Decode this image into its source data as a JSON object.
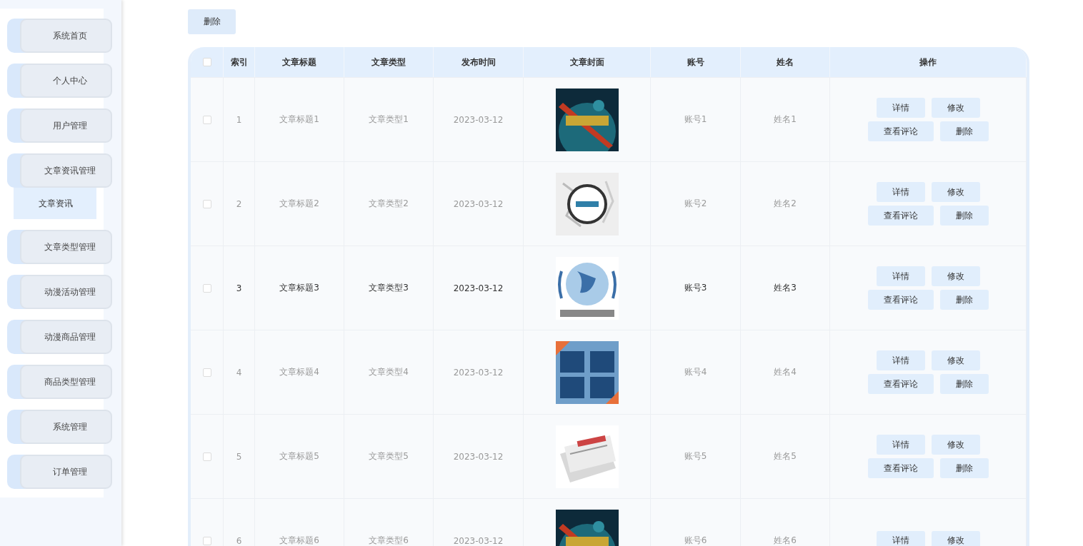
{
  "sidebar": {
    "items": [
      {
        "label": "系统首页",
        "selected": false
      },
      {
        "label": "个人中心",
        "selected": false
      },
      {
        "label": "用户管理",
        "selected": false
      },
      {
        "label": "文章资讯管理",
        "selected": false,
        "expanded": true,
        "children": [
          {
            "label": "文章资讯",
            "selected": true
          }
        ]
      },
      {
        "label": "文章类型管理",
        "selected": false
      },
      {
        "label": "动漫活动管理",
        "selected": false
      },
      {
        "label": "动漫商品管理",
        "selected": false
      },
      {
        "label": "商品类型管理",
        "selected": false
      },
      {
        "label": "系统管理",
        "selected": false
      },
      {
        "label": "订单管理",
        "selected": false
      }
    ]
  },
  "toolbar": {
    "delete_button": "删除"
  },
  "table": {
    "select_all": false,
    "columns": [
      "索引",
      "文章标题",
      "文章类型",
      "发布时间",
      "文章封面",
      "账号",
      "姓名",
      "操作"
    ],
    "rows": [
      {
        "checked": false,
        "hovered": false,
        "index": "1",
        "title": "文章标题1",
        "type": "文章类型1",
        "date": "2023-03-12",
        "account": "账号1",
        "name": "姓名1",
        "actions": [
          "详情",
          "修改",
          "查看评论",
          "删除"
        ]
      },
      {
        "checked": false,
        "hovered": false,
        "index": "2",
        "title": "文章标题2",
        "type": "文章类型2",
        "date": "2023-03-12",
        "account": "账号2",
        "name": "姓名2",
        "actions": [
          "详情",
          "修改",
          "查看评论",
          "删除"
        ]
      },
      {
        "checked": false,
        "hovered": true,
        "index": "3",
        "title": "文章标题3",
        "type": "文章类型3",
        "date": "2023-03-12",
        "account": "账号3",
        "name": "姓名3",
        "actions": [
          "详情",
          "修改",
          "查看评论",
          "删除"
        ]
      },
      {
        "checked": false,
        "hovered": false,
        "index": "4",
        "title": "文章标题4",
        "type": "文章类型4",
        "date": "2023-03-12",
        "account": "账号4",
        "name": "姓名4",
        "actions": [
          "详情",
          "修改",
          "查看评论",
          "删除"
        ]
      },
      {
        "checked": false,
        "hovered": false,
        "index": "5",
        "title": "文章标题5",
        "type": "文章类型5",
        "date": "2023-03-12",
        "account": "账号5",
        "name": "姓名5",
        "actions": [
          "详情",
          "修改",
          "查看评论",
          "删除"
        ]
      },
      {
        "checked": false,
        "hovered": false,
        "index": "6",
        "title": "文章标题6",
        "type": "文章类型6",
        "date": "2023-03-12",
        "account": "账号6",
        "name": "姓名6",
        "actions": [
          "详情",
          "修改"
        ]
      }
    ]
  }
}
